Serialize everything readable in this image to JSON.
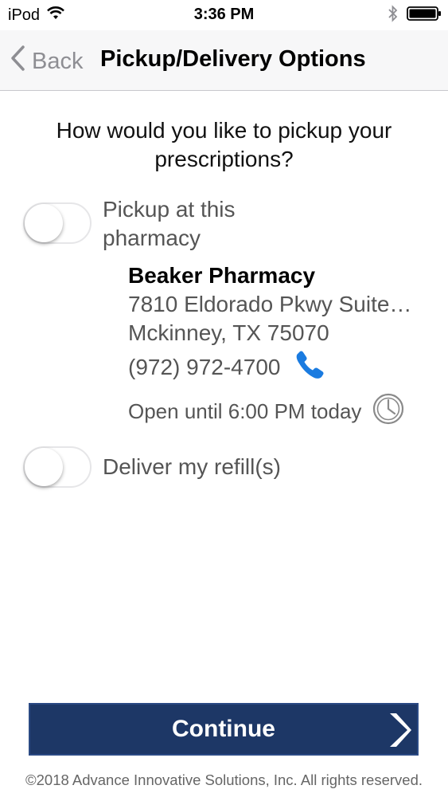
{
  "status_bar": {
    "carrier": "iPod",
    "time": "3:36 PM"
  },
  "nav": {
    "back_label": "Back",
    "title": "Pickup/Delivery Options"
  },
  "question": "How would you like to pickup your prescriptions?",
  "options": [
    {
      "label": "Pickup at this pharmacy",
      "enabled": false
    },
    {
      "label": "Deliver my refill(s)",
      "enabled": false
    }
  ],
  "pharmacy": {
    "name": "Beaker Pharmacy",
    "address_line1": "7810 Eldorado Pkwy Suite…",
    "address_line2": "Mckinney, TX 75070",
    "phone": "(972) 972-4700",
    "hours": "Open until 6:00 PM today"
  },
  "continue_label": "Continue",
  "footer": "©2018 Advance Innovative Solutions, Inc. All rights reserved.",
  "colors": {
    "continue_bg": "#1d3766",
    "phone_icon": "#1a7be0",
    "nav_bg": "#f7f7f8"
  }
}
